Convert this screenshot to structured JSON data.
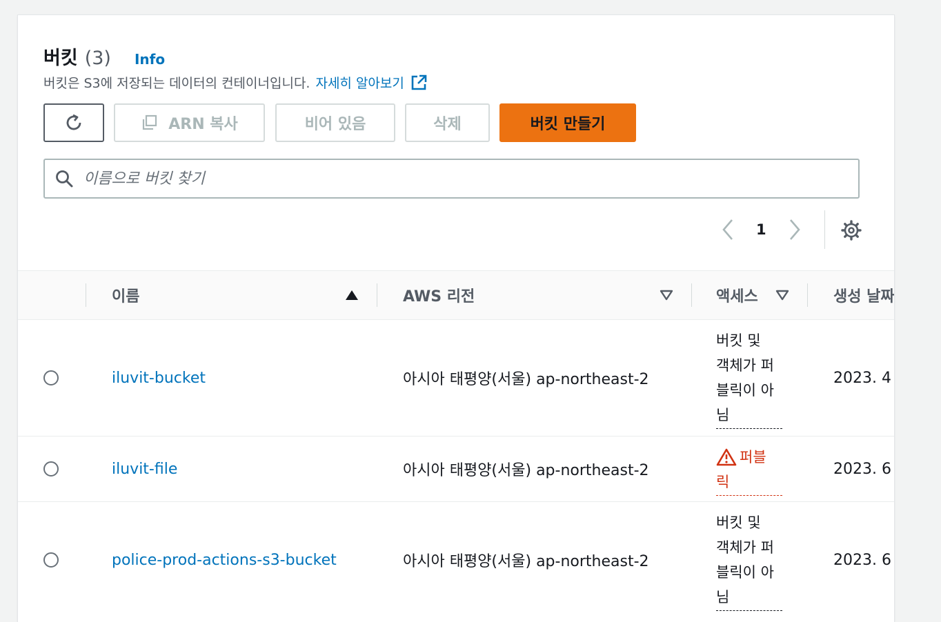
{
  "header": {
    "title": "버킷",
    "count": "(3)",
    "info": "Info",
    "description": "버킷은 S3에 저장되는 데이터의 컨테이너입니다.",
    "learn_more": "자세히 알아보기"
  },
  "toolbar": {
    "refresh_icon": "refresh-icon",
    "copy_arn": "ARN 복사",
    "empty": "비어 있음",
    "delete": "삭제",
    "create": "버킷 만들기"
  },
  "search": {
    "placeholder": "이름으로 버킷 찾기",
    "value": ""
  },
  "pagination": {
    "page": "1"
  },
  "table": {
    "columns": {
      "name": "이름",
      "region": "AWS 리전",
      "access": "액세스",
      "created": "생성 날짜"
    },
    "rows": [
      {
        "name": "iluvit-bucket",
        "region": "아시아 태평양(서울) ap-northeast-2",
        "access_lines": [
          "버킷 및",
          "객체가 퍼",
          "블릭이 아",
          "님"
        ],
        "access_status": "not-public",
        "created": "2023. 4"
      },
      {
        "name": "iluvit-file",
        "region": "아시아 태평양(서울) ap-northeast-2",
        "access_lines": [
          "퍼블",
          "릭"
        ],
        "access_status": "public",
        "created": "2023. 6"
      },
      {
        "name": "police-prod-actions-s3-bucket",
        "region": "아시아 태평양(서울) ap-northeast-2",
        "access_lines": [
          "버킷 및",
          "객체가 퍼",
          "블릭이 아",
          "님"
        ],
        "access_status": "not-public",
        "created": "2023. 6"
      }
    ]
  },
  "colors": {
    "accent_orange": "#ec7211",
    "link_blue": "#0073bb",
    "public_red": "#d13212"
  }
}
